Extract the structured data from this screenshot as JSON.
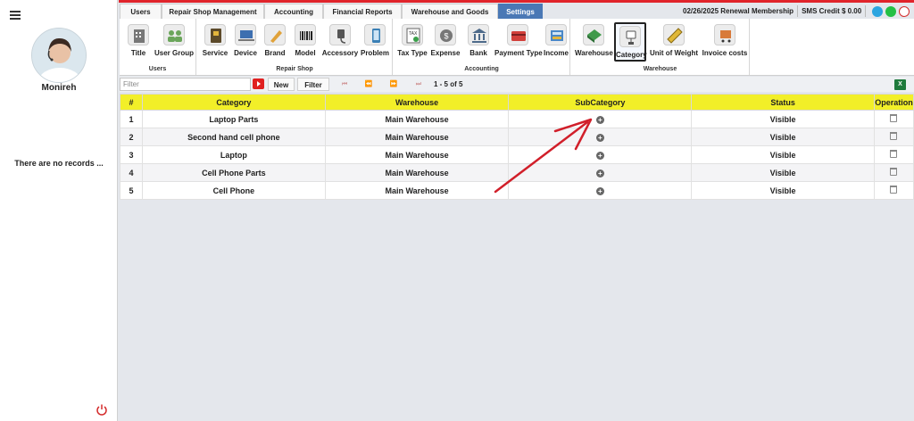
{
  "sidebar": {
    "username": "Monireh",
    "empty_message": "There are no records ..."
  },
  "tabs": [
    {
      "label": "Users",
      "active": false
    },
    {
      "label": "Repair Shop Management",
      "active": false
    },
    {
      "label": "Accounting",
      "active": false
    },
    {
      "label": "Financial Reports",
      "active": false
    },
    {
      "label": "Warehouse and Goods",
      "active": false
    },
    {
      "label": "Settings",
      "active": true
    }
  ],
  "status": {
    "renewal": "02/26/2025 Renewal Membership",
    "sms_credit": "SMS Credit $ 0.00"
  },
  "ribbon": {
    "groups": [
      {
        "label": "Users",
        "buttons": [
          {
            "label": "Title",
            "icon": "building-icon"
          },
          {
            "label": "User Group",
            "icon": "user-group-icon"
          }
        ]
      },
      {
        "label": "Repair Shop",
        "buttons": [
          {
            "label": "Service",
            "icon": "tools-icon"
          },
          {
            "label": "Device",
            "icon": "laptop-icon"
          },
          {
            "label": "Brand",
            "icon": "tag-icon"
          },
          {
            "label": "Model",
            "icon": "barcode-icon"
          },
          {
            "label": "Accessory",
            "icon": "charger-icon"
          },
          {
            "label": "Problem",
            "icon": "phone-problem-icon"
          }
        ]
      },
      {
        "label": "Accounting",
        "buttons": [
          {
            "label": "Tax Type",
            "icon": "tax-icon"
          },
          {
            "label": "Expense",
            "icon": "coin-icon"
          },
          {
            "label": "Bank",
            "icon": "bank-icon"
          },
          {
            "label": "Payment Type",
            "icon": "card-icon"
          },
          {
            "label": "Income",
            "icon": "register-icon"
          }
        ]
      },
      {
        "label": "Warehouse",
        "buttons": [
          {
            "label": "Warehouse",
            "icon": "warehouse-icon"
          },
          {
            "label": "Category",
            "icon": "category-icon",
            "selected": true
          },
          {
            "label": "Unit of Weight",
            "icon": "ruler-icon"
          },
          {
            "label": "Invoice costs",
            "icon": "cart-icon"
          }
        ]
      }
    ]
  },
  "filterbar": {
    "placeholder": "Filter",
    "new_label": "New",
    "filter_label": "Filter",
    "pager": "1 - 5 of 5"
  },
  "grid": {
    "columns": [
      "#",
      "Category",
      "Warehouse",
      "SubCategory",
      "Status",
      "Operation"
    ],
    "rows": [
      {
        "num": "1",
        "category": "Laptop Parts",
        "warehouse": "Main Warehouse",
        "status": "Visible"
      },
      {
        "num": "2",
        "category": "Second hand cell phone",
        "warehouse": "Main Warehouse",
        "status": "Visible"
      },
      {
        "num": "3",
        "category": "Laptop",
        "warehouse": "Main Warehouse",
        "status": "Visible"
      },
      {
        "num": "4",
        "category": "Cell Phone Parts",
        "warehouse": "Main Warehouse",
        "status": "Visible"
      },
      {
        "num": "5",
        "category": "Cell Phone",
        "warehouse": "Main Warehouse",
        "status": "Visible"
      }
    ]
  },
  "colors": {
    "accent_red": "#e0242b",
    "tab_active": "#4a78b5",
    "header_yellow": "#f2ef28",
    "annotation_arrow": "#d11f2a"
  }
}
